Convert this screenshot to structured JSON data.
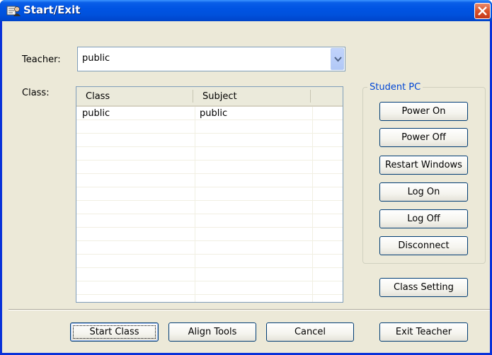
{
  "window": {
    "title": "Start/Exit",
    "icon": "teacher-app-icon",
    "close_icon": "close-icon"
  },
  "teacher": {
    "label": "Teacher:",
    "value": "public"
  },
  "class_section": {
    "label": "Class:",
    "columns": [
      "Class",
      "Subject"
    ],
    "rows": [
      {
        "class": "public",
        "subject": "public"
      }
    ]
  },
  "student_pc": {
    "title": "Student PC",
    "buttons": [
      "Power On",
      "Power Off",
      "Restart Windows",
      "Log On",
      "Log Off",
      "Disconnect"
    ]
  },
  "class_setting_label": "Class Setting",
  "footer": {
    "start_class": "Start Class",
    "align_tools": "Align Tools",
    "cancel": "Cancel",
    "exit_teacher": "Exit Teacher"
  },
  "colors": {
    "titlebar": "#0054e3",
    "dialog_bg": "#ece9d8",
    "group_title": "#0046d5",
    "close_button": "#d9532a"
  }
}
